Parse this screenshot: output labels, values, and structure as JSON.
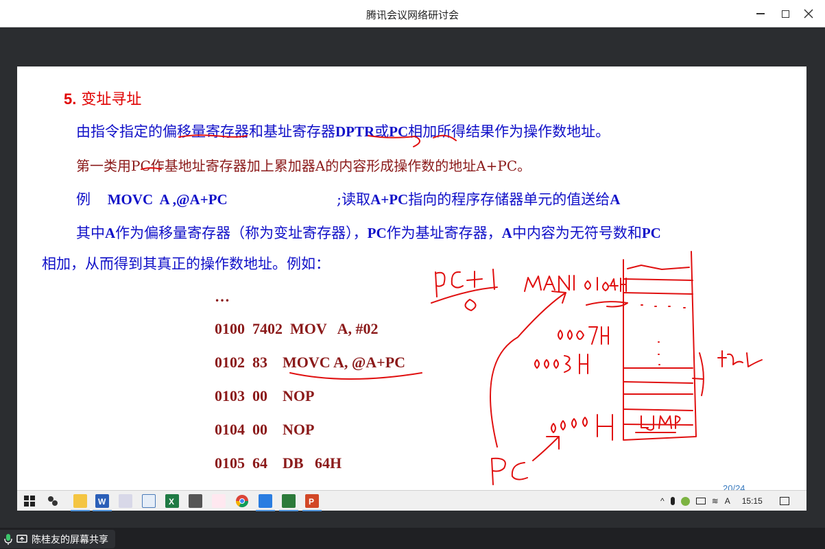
{
  "window": {
    "title": "腾讯会议网络研讨会",
    "minimize_icon": "minimize-icon",
    "maximize_icon": "maximize-icon",
    "close_icon": "close-icon"
  },
  "slide": {
    "heading_num": "5.",
    "heading_text": " 变址寻址",
    "line1": {
      "a": "由指令指定的偏移量寄存器和基址寄存器",
      "b": "DPTR",
      "c": "或",
      "d": "PC",
      "e": "相加所得结果作为操作数地址。"
    },
    "line2": "第一类用PC作基地址寄存器加上累加器A的内容形成操作数的地址A+PC。",
    "example": {
      "label": "例",
      "instr": "MOVC  A ,@A+PC",
      "comment_a": ";读取",
      "comment_b": "A+PC",
      "comment_c": "指向的程序存储器单元的值送给",
      "comment_d": "A"
    },
    "line4": {
      "a": "其中",
      "b": "A",
      "c": "作为偏移量寄存器（称为变址寄存器），",
      "d": "PC",
      "e": "作为基址寄存器，",
      "f": "A",
      "g": "中内容为无符号数和",
      "h": "PC"
    },
    "line5": "相加，从而得到其真正的操作数地址。例如：",
    "code": [
      "…",
      "0100  7402  MOV   A, #02",
      "0102  83    MOVC A, @A+PC",
      "0103  00    NOP",
      "0104  00    NOP",
      "0105  64    DB   64H"
    ],
    "page_number": "20/24"
  },
  "taskbar": {
    "apps": [
      "windows-start-icon",
      "settings-app-icon",
      "file-explorer-icon",
      "word-icon",
      "ebook-icon",
      "remote-desktop-icon",
      "excel-icon",
      "monitor-icon",
      "wifi-app-icon",
      "chrome-icon",
      "tencent-meeting-icon",
      "wps-icon",
      "powerpoint-icon"
    ],
    "clock": "15:15"
  },
  "share_indicator": {
    "label": "陈桂友的屏幕共享"
  }
}
